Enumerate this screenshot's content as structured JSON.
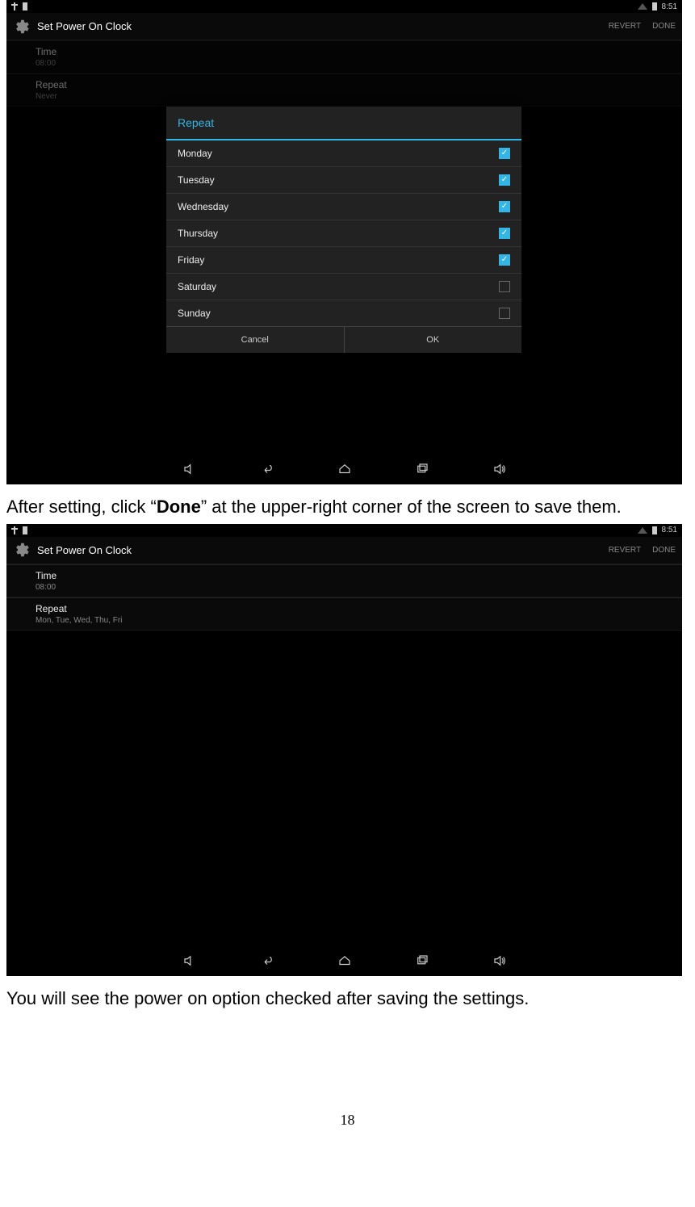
{
  "statusbar": {
    "time": "8:51"
  },
  "header": {
    "title": "Set Power On Clock",
    "revert": "REVERT",
    "done": "DONE"
  },
  "s1_rows": {
    "time_label": "Time",
    "time_value": "08:00",
    "repeat_label": "Repeat",
    "repeat_value": "Never"
  },
  "dialog": {
    "title": "Repeat",
    "days": [
      {
        "name": "Monday",
        "checked": true
      },
      {
        "name": "Tuesday",
        "checked": true
      },
      {
        "name": "Wednesday",
        "checked": true
      },
      {
        "name": "Thursday",
        "checked": true
      },
      {
        "name": "Friday",
        "checked": true
      },
      {
        "name": "Saturday",
        "checked": false
      },
      {
        "name": "Sunday",
        "checked": false
      }
    ],
    "cancel": "Cancel",
    "ok": "OK"
  },
  "s2_rows": {
    "time_label": "Time",
    "time_value": "08:00",
    "repeat_label": "Repeat",
    "repeat_value": "Mon, Tue, Wed, Thu, Fri"
  },
  "doc": {
    "para1a": "After setting, click “",
    "para1b": "Done",
    "para1c": "” at the upper-right corner of the screen to save them.",
    "para2": "You will see the power on option checked after saving the settings.",
    "page_number": "18"
  }
}
